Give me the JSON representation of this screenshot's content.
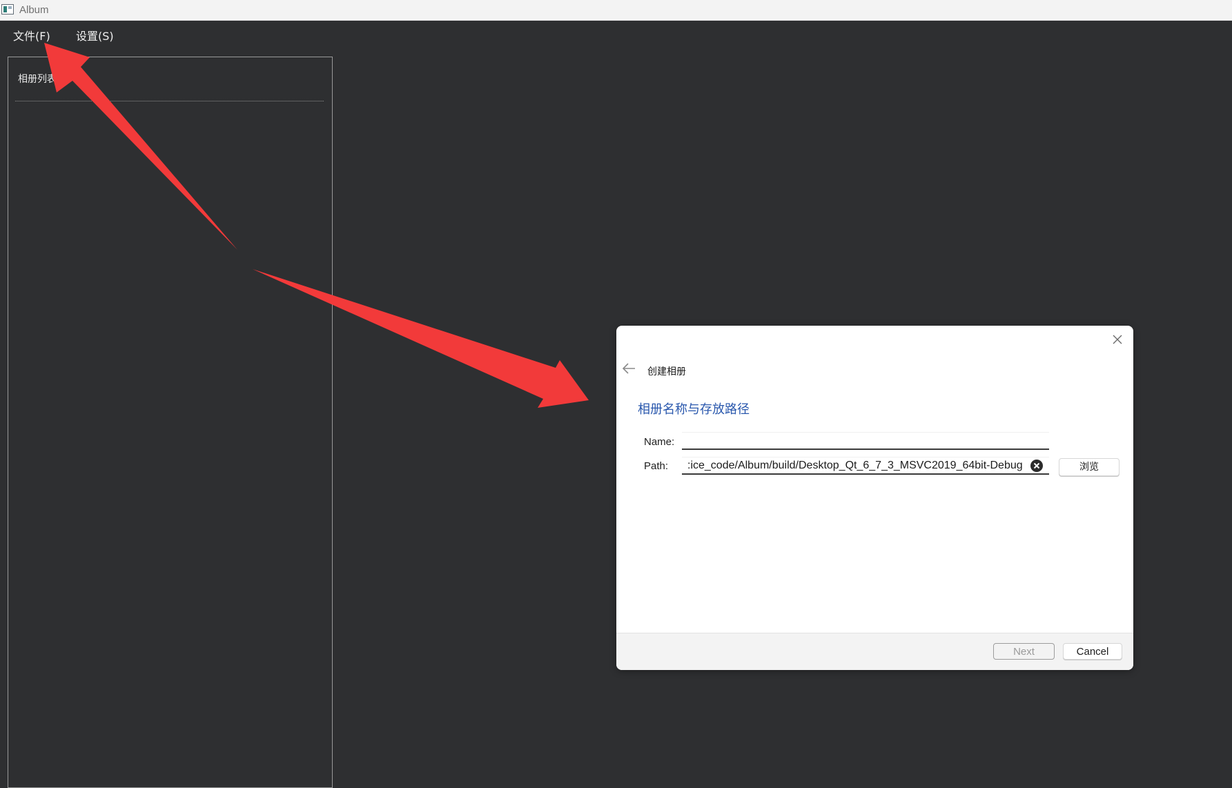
{
  "window": {
    "title": "Album"
  },
  "menu": {
    "items": [
      "文件(F)",
      "设置(S)"
    ]
  },
  "sidebar": {
    "title": "相册列表"
  },
  "dialog": {
    "title": "创建相册",
    "subtitle": "相册名称与存放路径",
    "name_label": "Name:",
    "name_value": "",
    "path_label": "Path:",
    "path_value": ":ice_code/Album/build/Desktop_Qt_6_7_3_MSVC2019_64bit-Debug",
    "browse_label": "浏览",
    "next_label": "Next",
    "cancel_label": "Cancel"
  },
  "colors": {
    "background": "#2e2f31",
    "subtitle": "#2a58ad",
    "annotation_arrow": "#f23a3a"
  },
  "icons": [
    "app-icon",
    "back-arrow-icon",
    "close-icon",
    "clear-icon"
  ]
}
